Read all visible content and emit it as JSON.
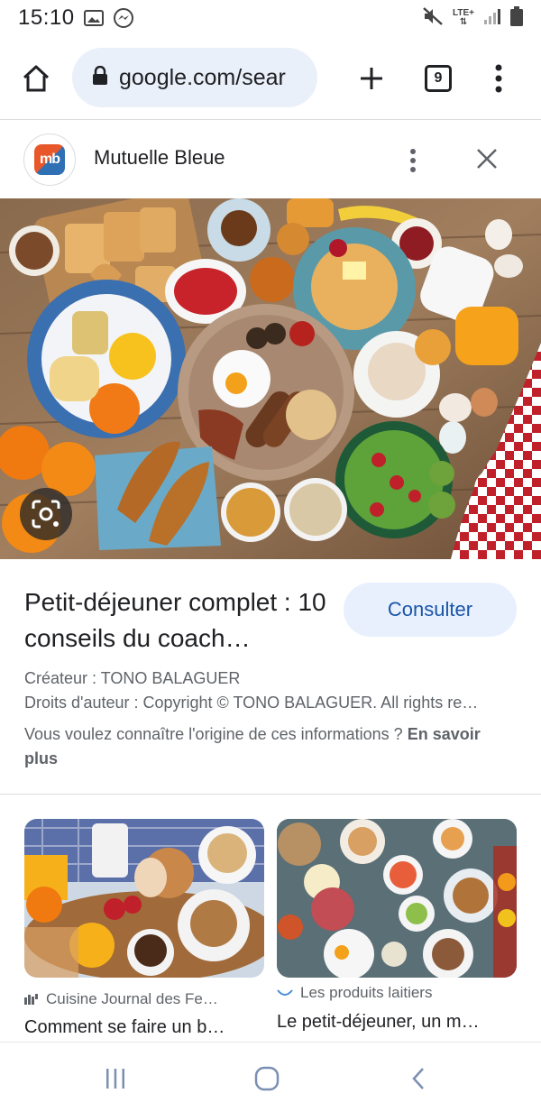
{
  "status_bar": {
    "time": "15:10",
    "network": "LTE+",
    "left_icons": [
      "image-icon",
      "messenger-icon"
    ],
    "right_icons": [
      "mute-icon",
      "lte-icon",
      "signal-icon",
      "battery-icon"
    ]
  },
  "toolbar": {
    "url": "google.com/sear",
    "tab_count": "9",
    "icons": [
      "home-icon",
      "lock-icon",
      "plus-icon",
      "tabs-icon",
      "more-vert-icon"
    ]
  },
  "source": {
    "logo_text": "mb",
    "name": "Mutuelle Bleue"
  },
  "result": {
    "title": "Petit-déjeuner complet : 10 conseils du coach…",
    "consult_label": "Consulter",
    "creator": "Créateur : TONO BALAGUER",
    "rights": "Droits d'auteur : Copyright © TONO BALAGUER. All rights re…",
    "info_question": "Vous voulez connaître l'origine de ces informations ? ",
    "info_link": "En savoir plus"
  },
  "related": [
    {
      "source": "Cuisine Journal des Fe…",
      "title": "Comment se faire un b…"
    },
    {
      "source": "Les produits laitiers",
      "title": "Le petit-déjeuner, un m…"
    }
  ],
  "navbar": {
    "icons": [
      "recents-icon",
      "home-circle-icon",
      "back-icon"
    ]
  },
  "colors": {
    "accent_blue": "#1a56a8",
    "omnibox_bg": "#eaf0f9",
    "button_bg": "#e8f0fe"
  }
}
